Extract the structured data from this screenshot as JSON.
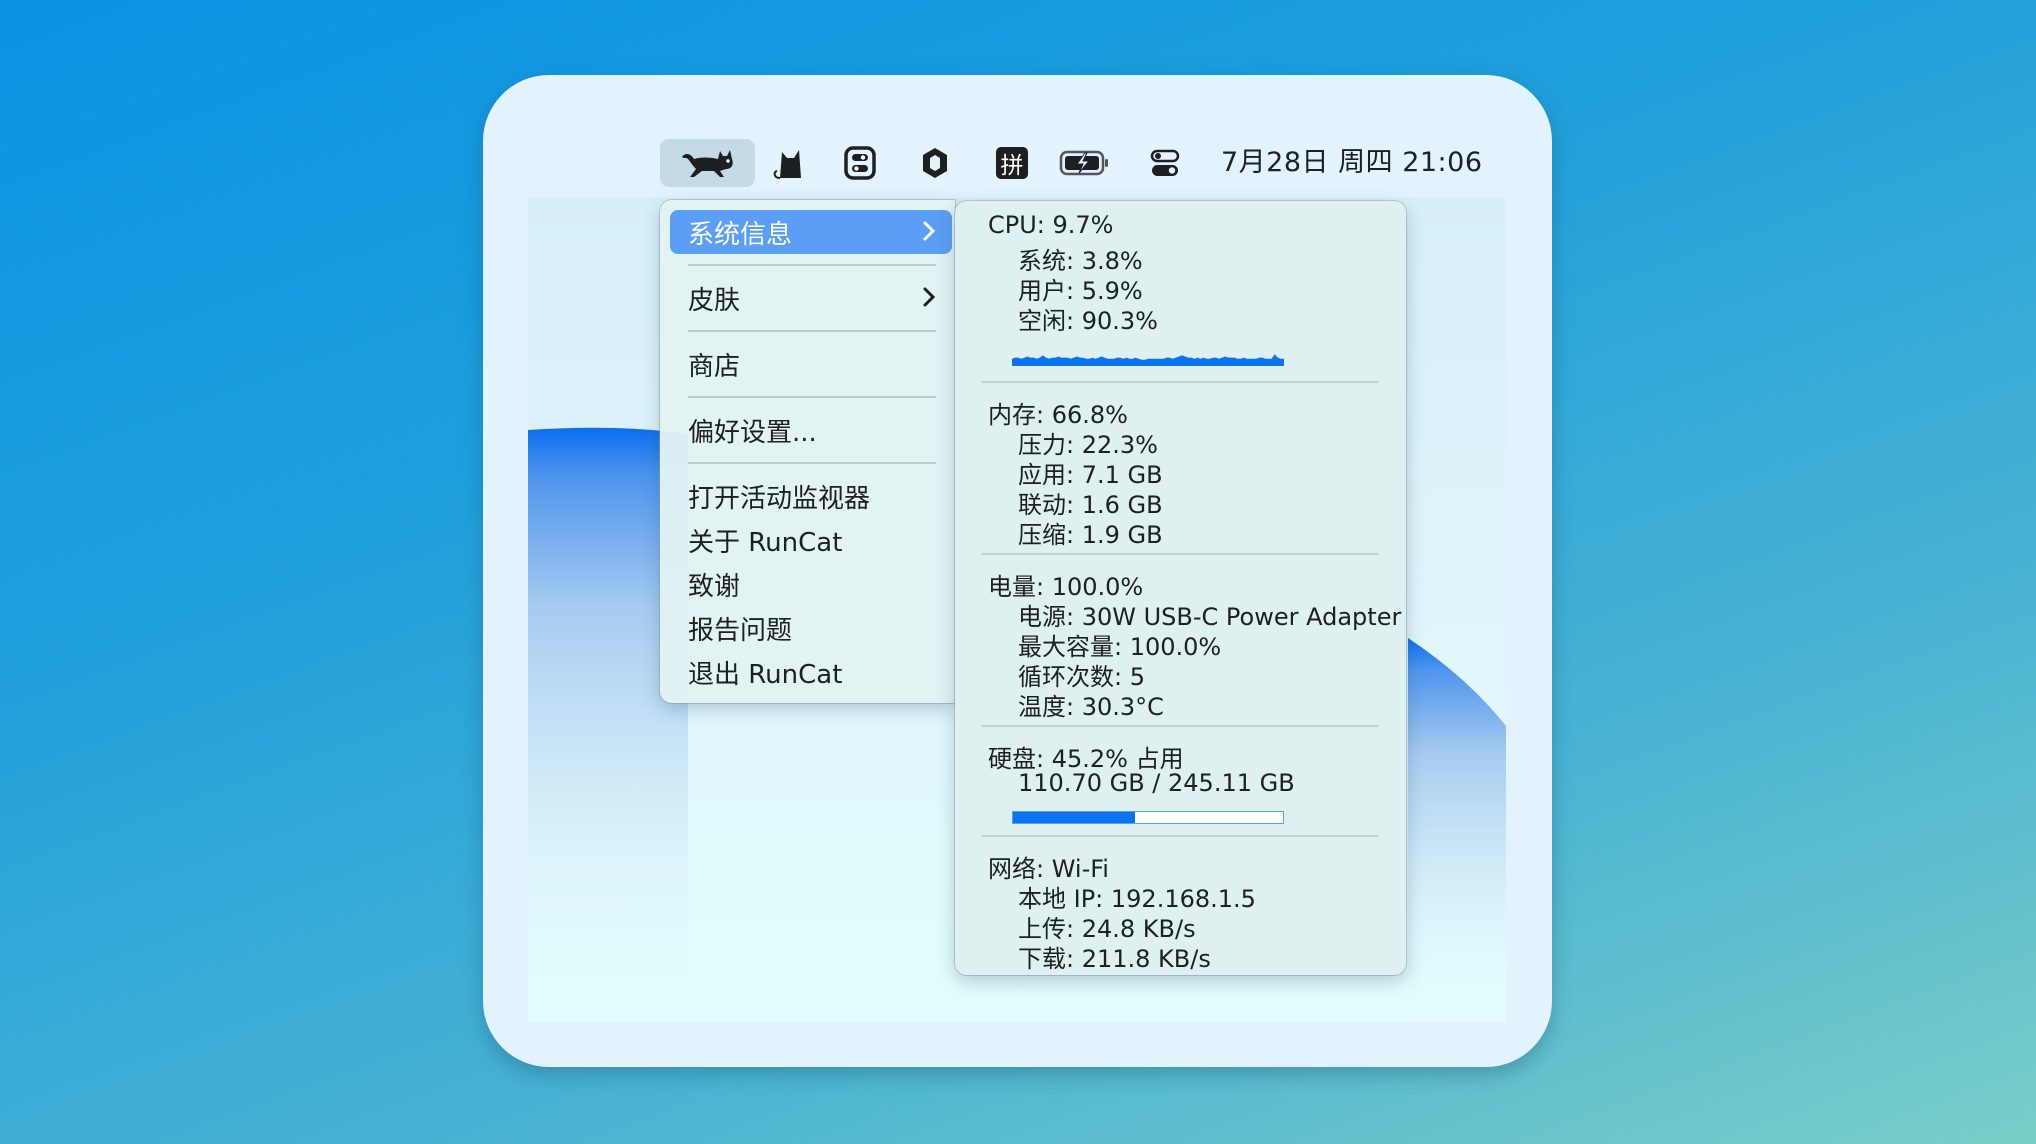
{
  "menubar": {
    "icons": [
      {
        "name": "runcat-running-cat-icon",
        "active": true
      },
      {
        "name": "cat-silhouette-icon"
      },
      {
        "name": "toggle-app-icon"
      },
      {
        "name": "hexagon-icon"
      },
      {
        "name": "pinyin-input-icon",
        "glyph": "拼"
      },
      {
        "name": "battery-charging-icon"
      },
      {
        "name": "control-center-icon"
      }
    ],
    "clock": "7月28日 周四  21:06"
  },
  "menu": {
    "items": [
      {
        "label": "系统信息",
        "submenu": true,
        "selected": true
      },
      {
        "label": "皮肤",
        "submenu": true
      },
      {
        "label": "商店"
      },
      {
        "label": "偏好设置..."
      },
      {
        "label": "打开活动监视器"
      },
      {
        "label": "关于 RunCat"
      },
      {
        "label": "致谢"
      },
      {
        "label": "报告问题"
      },
      {
        "label": "退出 RunCat"
      }
    ]
  },
  "system_info": {
    "cpu": {
      "title": "CPU:  9.7%",
      "lines": [
        "系统:  3.8%",
        "用户:  5.9%",
        "空闲: 90.3%"
      ],
      "history": [
        3,
        4,
        4,
        3,
        4,
        5,
        4,
        4,
        3,
        4,
        6,
        4,
        3,
        4,
        4,
        5,
        4,
        4,
        4,
        3,
        4,
        5,
        4,
        4,
        3,
        3,
        4,
        3,
        4,
        5,
        4,
        3,
        3,
        3,
        4,
        4,
        3,
        4,
        3,
        3,
        4,
        3,
        2,
        2,
        3,
        3,
        3,
        3,
        3,
        3,
        4,
        4,
        3,
        4,
        5,
        6,
        5,
        4,
        4,
        3,
        4,
        3,
        4,
        3,
        3,
        4,
        4,
        3,
        4,
        5,
        4,
        4,
        4,
        3,
        3,
        4,
        3,
        3,
        3,
        3,
        4,
        4,
        3,
        3,
        3,
        7,
        4,
        3,
        3
      ]
    },
    "memory": {
      "title": "内存: 66.8%",
      "lines": [
        "压力: 22.3%",
        "应用:  7.1 GB",
        "联动:  1.6 GB",
        "压缩:  1.9 GB"
      ]
    },
    "battery": {
      "title": "电量: 100.0%",
      "lines": [
        "电源: 30W USB-C Power Adapter",
        "最大容量: 100.0%",
        "循环次数: 5",
        "温度: 30.3°C"
      ]
    },
    "disk": {
      "title": "硬盘: 45.2% 占用",
      "lines": [
        "110.70 GB / 245.11 GB"
      ],
      "used_fraction": 0.452
    },
    "network": {
      "title": "网络: Wi-Fi",
      "lines": [
        "本地 IP: 192.168.1.5",
        "上传:  24.8 KB/s",
        "下载: 211.8 KB/s"
      ]
    }
  },
  "colors": {
    "accent": "#5a9ef5",
    "graph": "#0a74f0",
    "wave": "#0a6ef0"
  }
}
